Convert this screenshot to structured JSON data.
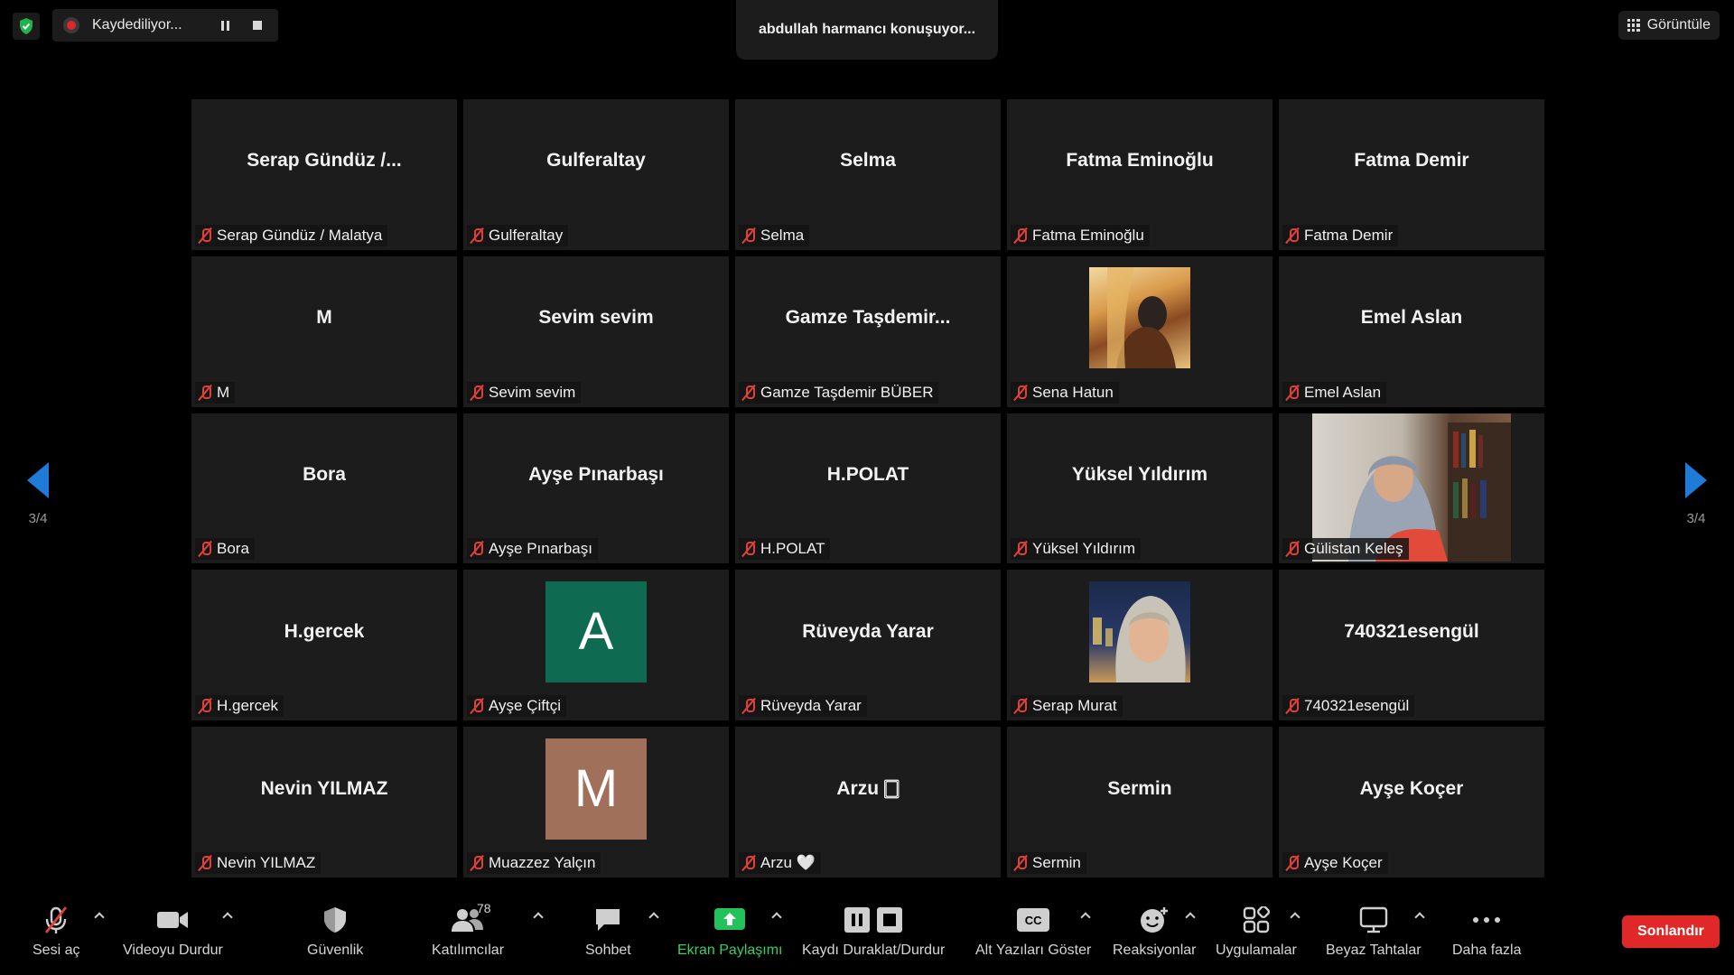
{
  "top": {
    "recording_label": "Kaydediliyor...",
    "speaker": "abdullah harmancı konuşuyor...",
    "view_label": "Görüntüle"
  },
  "nav": {
    "page_left": "3/4",
    "page_right": "3/4"
  },
  "tiles": [
    {
      "display": "Serap Gündüz /...",
      "name": "Serap Gündüz / Malatya"
    },
    {
      "display": "Gulferaltay",
      "name": "Gulferaltay"
    },
    {
      "display": "Selma",
      "name": "Selma"
    },
    {
      "display": "Fatma Eminoğlu",
      "name": "Fatma Eminoğlu"
    },
    {
      "display": "Fatma Demir",
      "name": "Fatma Demir"
    },
    {
      "display": "M",
      "name": "M"
    },
    {
      "display": "Sevim sevim",
      "name": "Sevim sevim"
    },
    {
      "display": "Gamze Taşdemir...",
      "name": "Gamze Taşdemir BÜBER"
    },
    {
      "display": "",
      "name": "Sena Hatun"
    },
    {
      "display": "Emel Aslan",
      "name": "Emel Aslan"
    },
    {
      "display": "Bora",
      "name": "Bora"
    },
    {
      "display": "Ayşe Pınarbaşı",
      "name": "Ayşe Pınarbaşı"
    },
    {
      "display": "H.POLAT",
      "name": "H.POLAT"
    },
    {
      "display": "Yüksel Yıldırım",
      "name": "Yüksel Yıldırım"
    },
    {
      "display": "",
      "name": "Gülistan Keleş"
    },
    {
      "display": "H.gercek",
      "name": "H.gercek"
    },
    {
      "display": "A",
      "name": "Ayşe Çiftçi"
    },
    {
      "display": "Rüveyda Yarar",
      "name": "Rüveyda Yarar"
    },
    {
      "display": "",
      "name": "Serap Murat"
    },
    {
      "display": "740321esengül",
      "name": "740321esengül"
    },
    {
      "display": "Nevin YILMAZ",
      "name": "Nevin YILMAZ"
    },
    {
      "display": "M",
      "name": "Muazzez Yalçın"
    },
    {
      "display": "Arzu 🀆",
      "name": "Arzu 🤍"
    },
    {
      "display": "Sermin",
      "name": "Sermin"
    },
    {
      "display": "Ayşe Koçer",
      "name": "Ayşe Koçer"
    }
  ],
  "avatar_colors": {
    "A": "#0f6a52",
    "M": "#a0705a"
  },
  "toolbar": {
    "unmute": "Sesi aç",
    "stop_video": "Videoyu Durdur",
    "security": "Güvenlik",
    "participants": "Katılımcılar",
    "participants_count": "78",
    "chat": "Sohbet",
    "share_screen": "Ekran Paylaşımı",
    "pause_stop_recording": "Kaydı Duraklat/Durdur",
    "captions": "Alt Yazıları Göster",
    "captions_badge": "CC",
    "reactions": "Reaksiyonlar",
    "apps": "Uygulamalar",
    "whiteboards": "Beyaz Tahtalar",
    "more": "Daha fazla",
    "end": "Sonlandır"
  }
}
